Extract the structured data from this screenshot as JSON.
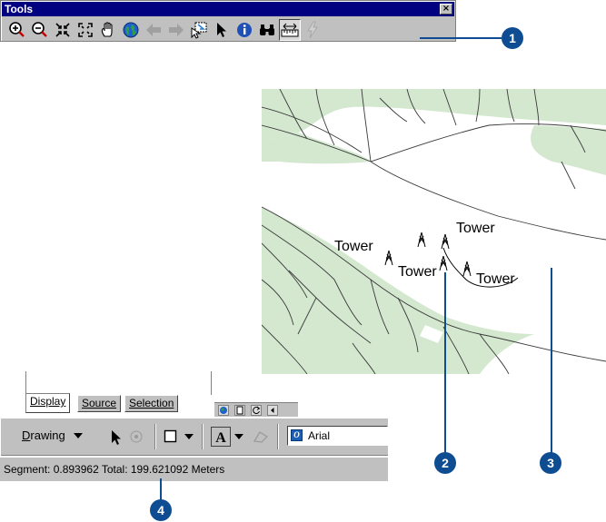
{
  "tools_toolbar": {
    "title": "Tools",
    "close_glyph": "×",
    "buttons": [
      {
        "icon": "zoom-in-icon"
      },
      {
        "icon": "zoom-out-icon"
      },
      {
        "icon": "fixed-zoom-in-icon"
      },
      {
        "icon": "fixed-zoom-out-icon"
      },
      {
        "icon": "pan-icon"
      },
      {
        "icon": "full-extent-icon"
      },
      {
        "icon": "back-extent-icon"
      },
      {
        "icon": "forward-extent-icon"
      },
      {
        "icon": "select-features-icon"
      },
      {
        "icon": "select-elements-icon"
      },
      {
        "icon": "identify-icon"
      },
      {
        "icon": "find-icon"
      },
      {
        "icon": "measure-icon",
        "pressed": true
      },
      {
        "icon": "hyperlink-icon",
        "disabled": true
      }
    ]
  },
  "map": {
    "labels": [
      "Tower",
      "Tower",
      "Tower",
      "Tower"
    ],
    "colors": {
      "land": "#d3e8cf",
      "line": "#3a3a3a",
      "measure_line": "#000000"
    }
  },
  "toc": {
    "tabs": [
      {
        "label": "Display",
        "active": true
      },
      {
        "label": "Source",
        "active": false
      },
      {
        "label": "Selection",
        "active": false
      }
    ]
  },
  "drawing_toolbar": {
    "menu_label": "Drawing",
    "menu_accelerator": "D",
    "font_name": "Arial",
    "font_icon_glyph": "O"
  },
  "status_bar": {
    "text": "Segment: 0.893962  Total: 199.621092  Meters"
  },
  "callouts": [
    "1",
    "2",
    "3",
    "4"
  ],
  "colors": {
    "callout": "#0e4d92",
    "toolbar": "#c0c0c0",
    "title_bar": "#000080"
  }
}
